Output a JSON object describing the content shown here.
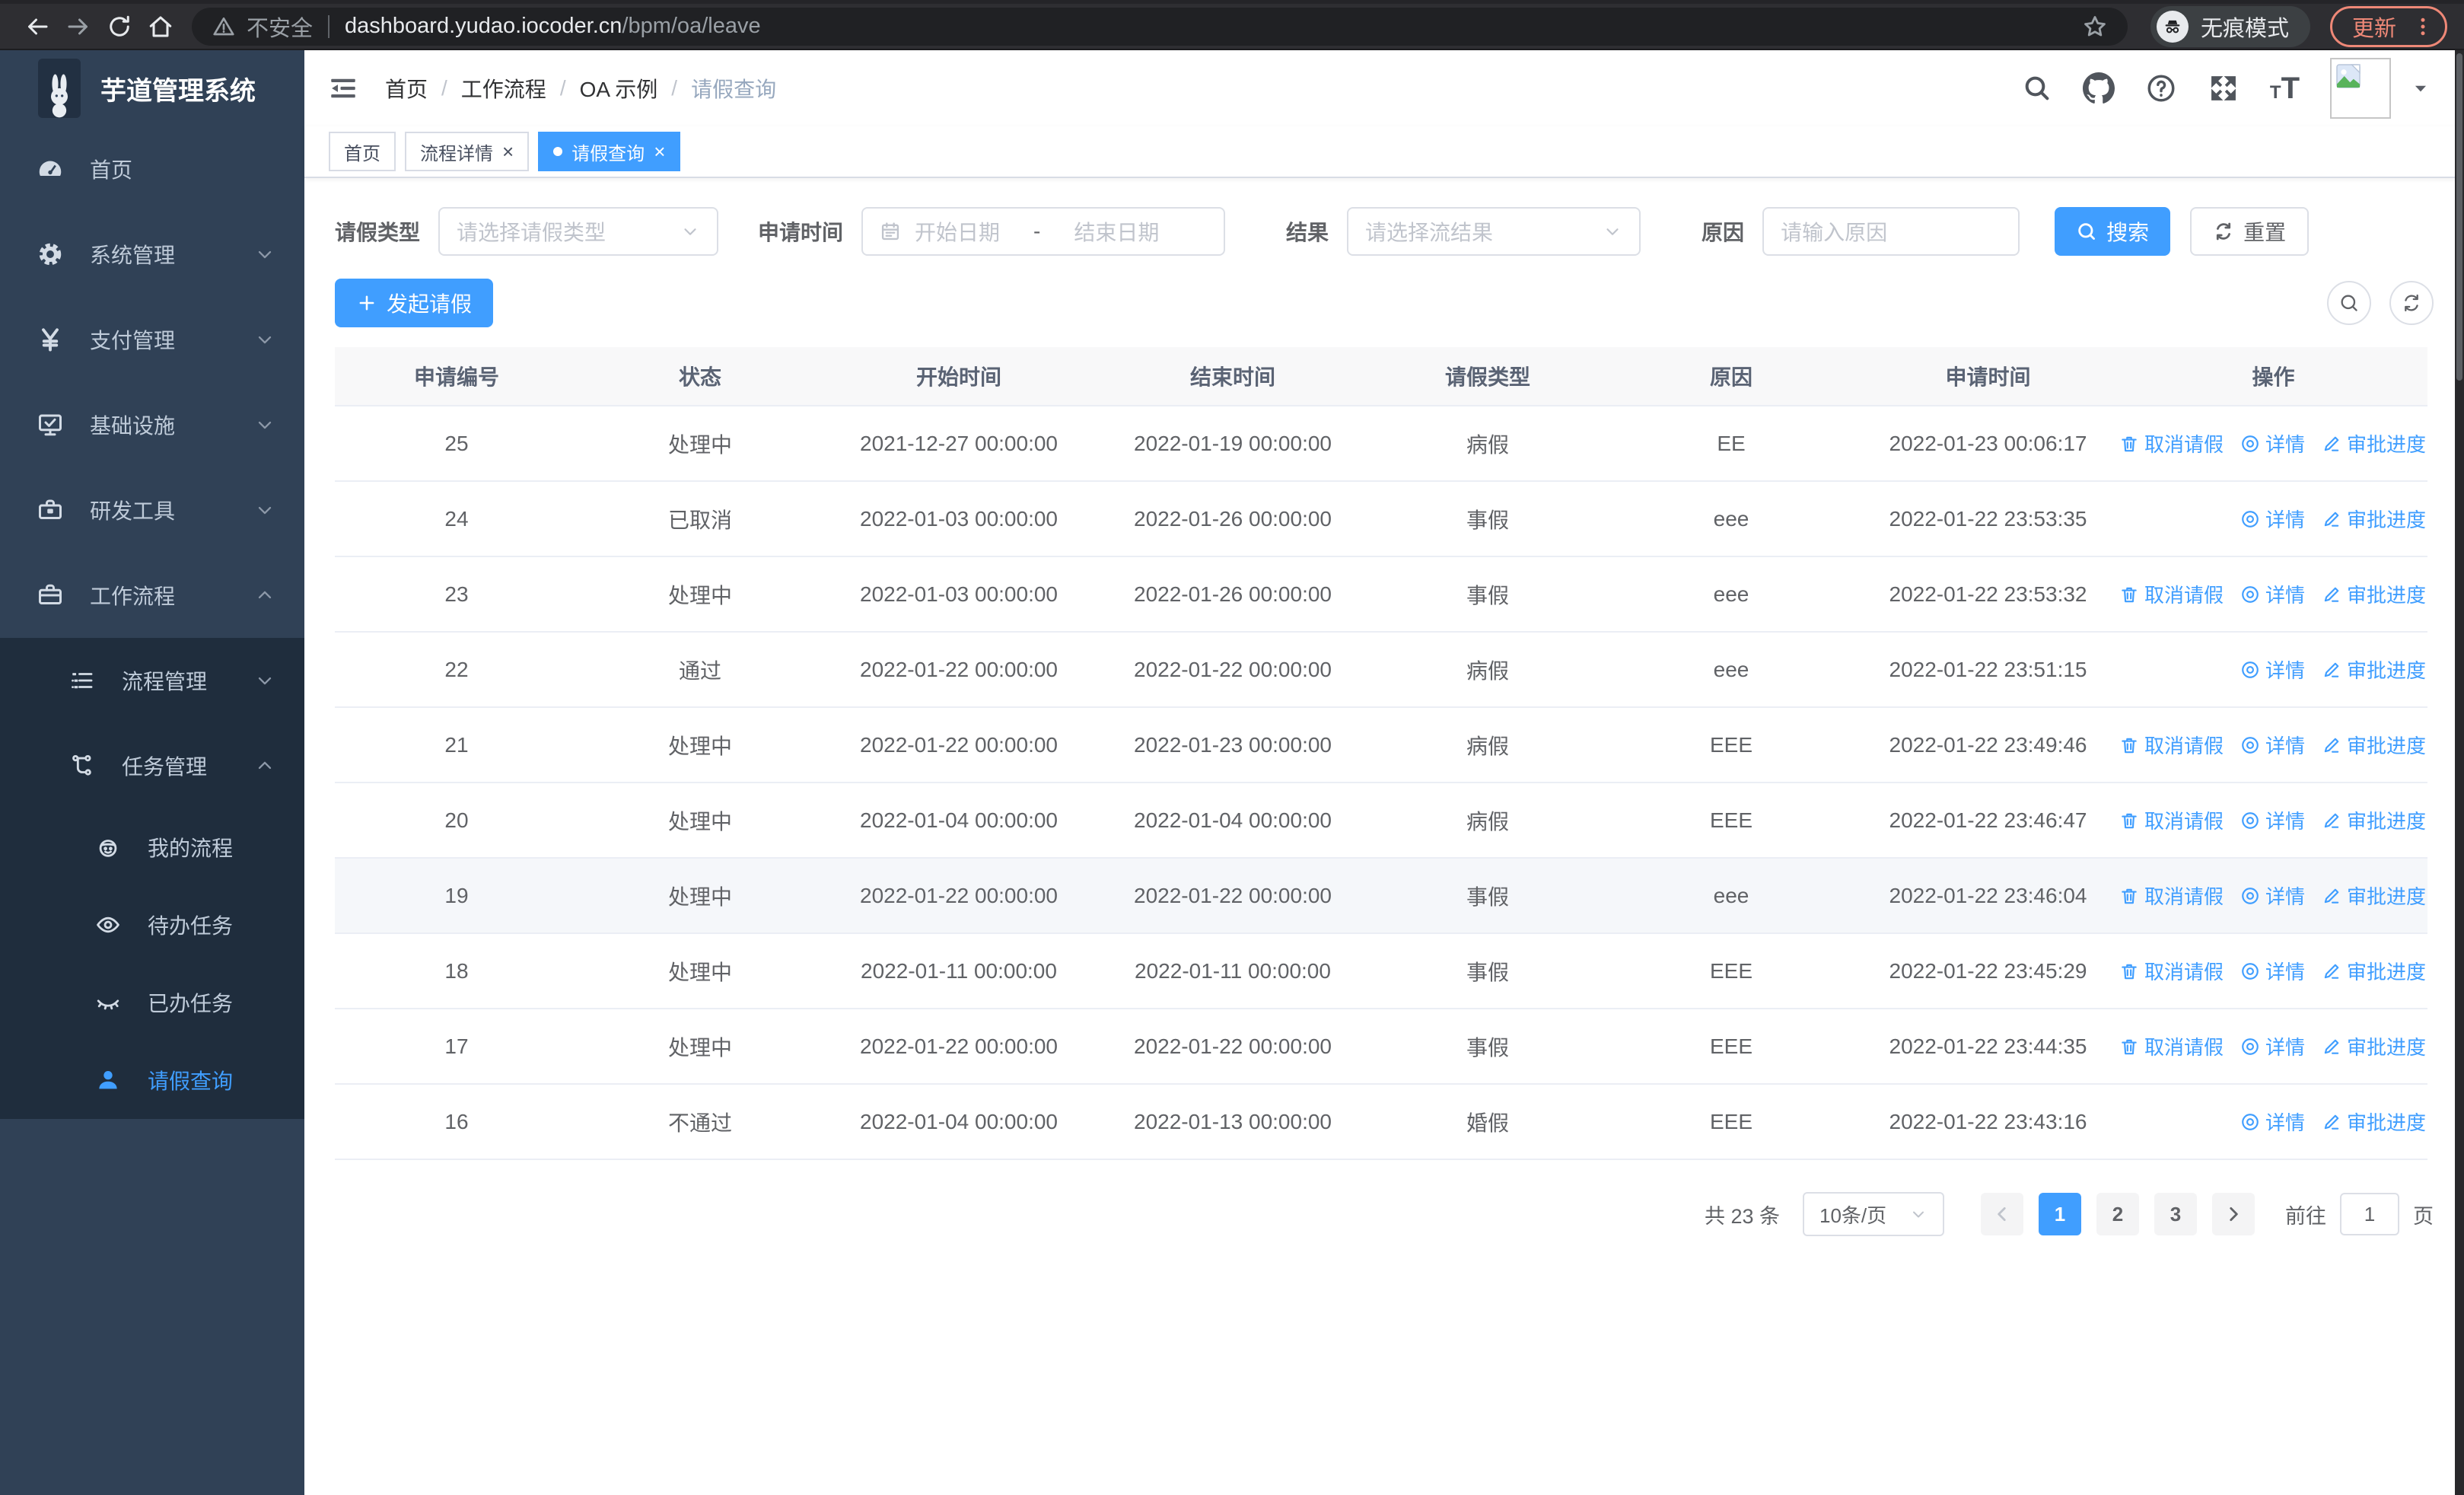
{
  "browser": {
    "security_label": "不安全",
    "url_host": "dashboard.yudao.iocoder.cn",
    "url_path": "/bpm/oa/leave",
    "incognito_label": "无痕模式",
    "update_label": "更新"
  },
  "logo": {
    "title": "芋道管理系统"
  },
  "sidebar": {
    "items": [
      {
        "label": "首页"
      },
      {
        "label": "系统管理"
      },
      {
        "label": "支付管理"
      },
      {
        "label": "基础设施"
      },
      {
        "label": "研发工具"
      },
      {
        "label": "工作流程"
      }
    ],
    "workflow_children": [
      {
        "label": "流程管理"
      },
      {
        "label": "任务管理"
      }
    ],
    "task_children": [
      {
        "label": "我的流程"
      },
      {
        "label": "待办任务"
      },
      {
        "label": "已办任务"
      },
      {
        "label": "请假查询",
        "active": true
      }
    ]
  },
  "breadcrumb": {
    "items": [
      "首页",
      "工作流程",
      "OA 示例",
      "请假查询"
    ]
  },
  "tabs": [
    {
      "label": "首页",
      "closable": false,
      "active": false
    },
    {
      "label": "流程详情",
      "closable": true,
      "active": false
    },
    {
      "label": "请假查询",
      "closable": true,
      "active": true
    }
  ],
  "filters": {
    "type_label": "请假类型",
    "type_placeholder": "请选择请假类型",
    "time_label": "申请时间",
    "start_placeholder": "开始日期",
    "range_separator": "-",
    "end_placeholder": "结束日期",
    "result_label": "结果",
    "result_placeholder": "请选择流结果",
    "reason_label": "原因",
    "reason_placeholder": "请输入原因",
    "search_label": "搜索",
    "reset_label": "重置"
  },
  "toolbar": {
    "create_label": "发起请假"
  },
  "table": {
    "headers": [
      "申请编号",
      "状态",
      "开始时间",
      "结束时间",
      "请假类型",
      "原因",
      "申请时间",
      "操作"
    ],
    "rows": [
      {
        "id": "25",
        "status": "处理中",
        "start": "2021-12-27 00:00:00",
        "end": "2022-01-19 00:00:00",
        "type": "病假",
        "reason": "EE",
        "applied": "2022-01-23 00:06:17",
        "highlighted": false,
        "actions": [
          {
            "label": "取消请假",
            "icon": "trash-icon",
            "name": "cancel-leave-link"
          },
          {
            "label": "详情",
            "icon": "view-icon",
            "name": "detail-link"
          },
          {
            "label": "审批进度",
            "icon": "edit-icon",
            "name": "approval-progress-link"
          }
        ]
      },
      {
        "id": "24",
        "status": "已取消",
        "start": "2022-01-03 00:00:00",
        "end": "2022-01-26 00:00:00",
        "type": "事假",
        "reason": "eee",
        "applied": "2022-01-22 23:53:35",
        "highlighted": false,
        "actions": [
          {
            "label": "详情",
            "icon": "view-icon",
            "name": "detail-link"
          },
          {
            "label": "审批进度",
            "icon": "edit-icon",
            "name": "approval-progress-link"
          }
        ]
      },
      {
        "id": "23",
        "status": "处理中",
        "start": "2022-01-03 00:00:00",
        "end": "2022-01-26 00:00:00",
        "type": "事假",
        "reason": "eee",
        "applied": "2022-01-22 23:53:32",
        "highlighted": false,
        "actions": [
          {
            "label": "取消请假",
            "icon": "trash-icon",
            "name": "cancel-leave-link"
          },
          {
            "label": "详情",
            "icon": "view-icon",
            "name": "detail-link"
          },
          {
            "label": "审批进度",
            "icon": "edit-icon",
            "name": "approval-progress-link"
          }
        ]
      },
      {
        "id": "22",
        "status": "通过",
        "start": "2022-01-22 00:00:00",
        "end": "2022-01-22 00:00:00",
        "type": "病假",
        "reason": "eee",
        "applied": "2022-01-22 23:51:15",
        "highlighted": false,
        "actions": [
          {
            "label": "详情",
            "icon": "view-icon",
            "name": "detail-link"
          },
          {
            "label": "审批进度",
            "icon": "edit-icon",
            "name": "approval-progress-link"
          }
        ]
      },
      {
        "id": "21",
        "status": "处理中",
        "start": "2022-01-22 00:00:00",
        "end": "2022-01-23 00:00:00",
        "type": "病假",
        "reason": "EEE",
        "applied": "2022-01-22 23:49:46",
        "highlighted": false,
        "actions": [
          {
            "label": "取消请假",
            "icon": "trash-icon",
            "name": "cancel-leave-link"
          },
          {
            "label": "详情",
            "icon": "view-icon",
            "name": "detail-link"
          },
          {
            "label": "审批进度",
            "icon": "edit-icon",
            "name": "approval-progress-link"
          }
        ]
      },
      {
        "id": "20",
        "status": "处理中",
        "start": "2022-01-04 00:00:00",
        "end": "2022-01-04 00:00:00",
        "type": "病假",
        "reason": "EEE",
        "applied": "2022-01-22 23:46:47",
        "highlighted": false,
        "actions": [
          {
            "label": "取消请假",
            "icon": "trash-icon",
            "name": "cancel-leave-link"
          },
          {
            "label": "详情",
            "icon": "view-icon",
            "name": "detail-link"
          },
          {
            "label": "审批进度",
            "icon": "edit-icon",
            "name": "approval-progress-link"
          }
        ]
      },
      {
        "id": "19",
        "status": "处理中",
        "start": "2022-01-22 00:00:00",
        "end": "2022-01-22 00:00:00",
        "type": "事假",
        "reason": "eee",
        "applied": "2022-01-22 23:46:04",
        "highlighted": true,
        "actions": [
          {
            "label": "取消请假",
            "icon": "trash-icon",
            "name": "cancel-leave-link"
          },
          {
            "label": "详情",
            "icon": "view-icon",
            "name": "detail-link"
          },
          {
            "label": "审批进度",
            "icon": "edit-icon",
            "name": "approval-progress-link"
          }
        ]
      },
      {
        "id": "18",
        "status": "处理中",
        "start": "2022-01-11 00:00:00",
        "end": "2022-01-11 00:00:00",
        "type": "事假",
        "reason": "EEE",
        "applied": "2022-01-22 23:45:29",
        "highlighted": false,
        "actions": [
          {
            "label": "取消请假",
            "icon": "trash-icon",
            "name": "cancel-leave-link"
          },
          {
            "label": "详情",
            "icon": "view-icon",
            "name": "detail-link"
          },
          {
            "label": "审批进度",
            "icon": "edit-icon",
            "name": "approval-progress-link"
          }
        ]
      },
      {
        "id": "17",
        "status": "处理中",
        "start": "2022-01-22 00:00:00",
        "end": "2022-01-22 00:00:00",
        "type": "事假",
        "reason": "EEE",
        "applied": "2022-01-22 23:44:35",
        "highlighted": false,
        "actions": [
          {
            "label": "取消请假",
            "icon": "trash-icon",
            "name": "cancel-leave-link"
          },
          {
            "label": "详情",
            "icon": "view-icon",
            "name": "detail-link"
          },
          {
            "label": "审批进度",
            "icon": "edit-icon",
            "name": "approval-progress-link"
          }
        ]
      },
      {
        "id": "16",
        "status": "不通过",
        "start": "2022-01-04 00:00:00",
        "end": "2022-01-13 00:00:00",
        "type": "婚假",
        "reason": "EEE",
        "applied": "2022-01-22 23:43:16",
        "highlighted": false,
        "actions": [
          {
            "label": "详情",
            "icon": "view-icon",
            "name": "detail-link"
          },
          {
            "label": "审批进度",
            "icon": "edit-icon",
            "name": "approval-progress-link"
          }
        ]
      }
    ]
  },
  "pagination": {
    "total_label": "共 23 条",
    "size_label": "10条/页",
    "pages": [
      "1",
      "2",
      "3"
    ],
    "active_page": "1",
    "goto_label": "前往",
    "goto_value": "1",
    "page_unit": "页"
  },
  "colors": {
    "primary": "#409eff",
    "sidebar_bg": "#304156",
    "submenu_bg": "#1f2d3d",
    "update_accent": "#ee8877"
  }
}
